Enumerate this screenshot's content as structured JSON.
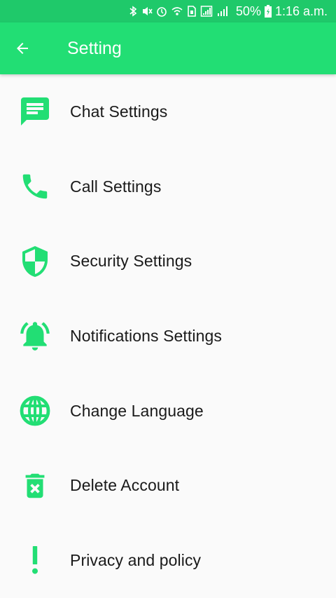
{
  "status_bar": {
    "battery": "50%",
    "time": "1:16 a.m."
  },
  "app_bar": {
    "title": "Setting"
  },
  "menu": [
    {
      "label": "Chat Settings",
      "icon": "chat-icon"
    },
    {
      "label": "Call Settings",
      "icon": "phone-icon"
    },
    {
      "label": "Security Settings",
      "icon": "shield-icon"
    },
    {
      "label": "Notifications Settings",
      "icon": "bell-icon"
    },
    {
      "label": "Change Language",
      "icon": "globe-icon"
    },
    {
      "label": "Delete Account",
      "icon": "trash-icon"
    },
    {
      "label": "Privacy and policy",
      "icon": "exclamation-icon"
    }
  ],
  "colors": {
    "status_bar": "#1fc96a",
    "app_bar": "#22de74",
    "icon": "#22de74",
    "background": "#fafafa"
  }
}
